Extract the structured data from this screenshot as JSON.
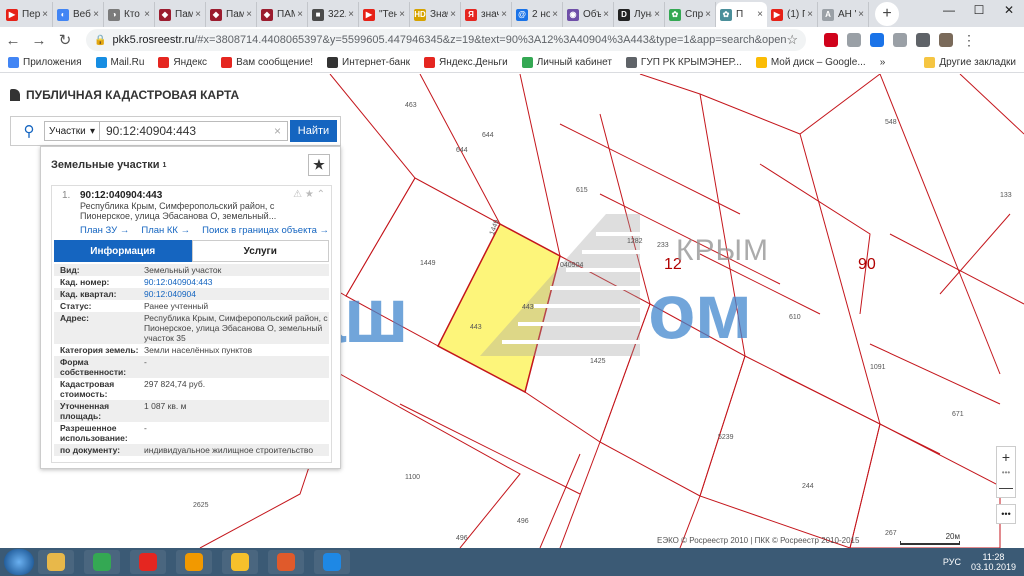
{
  "browser": {
    "tabs": [
      {
        "title": "Пере",
        "color": "#e62117",
        "glyph": "▶"
      },
      {
        "title": "Веб-",
        "color": "#4285f4",
        "glyph": "◐"
      },
      {
        "title": "Кто с",
        "color": "#7b7b7b",
        "glyph": "◑"
      },
      {
        "title": "Памя",
        "color": "#9b1c2e",
        "glyph": "◆"
      },
      {
        "title": "Памя",
        "color": "#9b1c2e",
        "glyph": "◆"
      },
      {
        "title": "ПАМ",
        "color": "#9b1c2e",
        "glyph": "◆"
      },
      {
        "title": "322.р",
        "color": "#4a4a4a",
        "glyph": "■"
      },
      {
        "title": "\"Тень",
        "color": "#e62117",
        "glyph": "▶"
      },
      {
        "title": "Знач",
        "color": "#d6a300",
        "glyph": "HD"
      },
      {
        "title": "знача",
        "color": "#e52620",
        "glyph": "Я"
      },
      {
        "title": "2 нос",
        "color": "#1a73e8",
        "glyph": "@"
      },
      {
        "title": "Объя",
        "color": "#6f4fa8",
        "glyph": "◉"
      },
      {
        "title": "Луна",
        "color": "#222222",
        "glyph": "D"
      },
      {
        "title": "Спра",
        "color": "#34a853",
        "glyph": "✿"
      },
      {
        "title": "П",
        "color": "#4b8f9a",
        "glyph": "✿"
      },
      {
        "title": "(1) П",
        "color": "#e62117",
        "glyph": "▶"
      },
      {
        "title": "АН \"",
        "color": "#9aa0a6",
        "glyph": "A"
      }
    ],
    "active_tab_index": 14,
    "new_tab_label": "+",
    "window_controls": {
      "minimize": "—",
      "maximize": "☐",
      "close": "✕"
    },
    "nav": {
      "back": "←",
      "forward": "→",
      "reload": "↻"
    },
    "url": {
      "host": "pkk5.rosreestr.ru",
      "path": "/#x=3808714.4408065397&y=5599605.447946345&z=19&text=90%3A12%3A40904%3A443&type=1&app=search&opened=1"
    },
    "extensions": [
      {
        "name": "abp-icon",
        "color": "#d0021b"
      },
      {
        "name": "pdf-icon",
        "color": "#9aa0a6"
      },
      {
        "name": "shield-icon",
        "color": "#1a73e8"
      },
      {
        "name": "circle-icon",
        "color": "#9aa0a6"
      },
      {
        "name": "ring-icon",
        "color": "#5f6368"
      },
      {
        "name": "profile-icon",
        "color": "#7a6a5a"
      }
    ],
    "bookmarks": [
      {
        "label": "Приложения",
        "color": "#4285f4"
      },
      {
        "label": "Mail.Ru",
        "color": "#168de2"
      },
      {
        "label": "Яндекс",
        "color": "#e52620"
      },
      {
        "label": "Вам сообщение!",
        "color": "#e52620"
      },
      {
        "label": "Интернет-банк",
        "color": "#333333"
      },
      {
        "label": "Яндекс.Деньги",
        "color": "#e52620"
      },
      {
        "label": "Личный кабинет",
        "color": "#34a853"
      },
      {
        "label": "ГУП РК КРЫМЭНЕР...",
        "color": "#5f6368"
      },
      {
        "label": "Мой диск – Google...",
        "color": "#fbbc05"
      }
    ],
    "bookmarks_more": "»",
    "other_bookmarks": "Другие закладки"
  },
  "app": {
    "title": "ПУБЛИЧНАЯ КАДАСТРОВАЯ КАРТА",
    "search": {
      "type_label": "Участки",
      "query": "90:12:40904:443",
      "clear": "×",
      "button": "Найти"
    },
    "panel": {
      "heading": "Земельные участки",
      "count": "1",
      "star": "★",
      "item": {
        "index": "1.",
        "number": "90:12:040904:443",
        "address": "Республика Крым, Симферопольский район, с Пионерское, улица Эбасанова О, земельный...",
        "icons": "⚠ ★ ⌃",
        "links": [
          "План ЗУ →",
          "План КК →",
          "Поиск в границах объекта →"
        ],
        "tabs": [
          "Информация",
          "Услуги"
        ],
        "rows": [
          {
            "k": "Вид:",
            "v": "Земельный участок",
            "link": false
          },
          {
            "k": "Кад. номер:",
            "v": "90:12:040904:443",
            "link": true
          },
          {
            "k": "Кад. квартал:",
            "v": "90:12:040904",
            "link": true
          },
          {
            "k": "Статус:",
            "v": "Ранее учтенный",
            "link": false
          },
          {
            "k": "Адрес:",
            "v": "Республика Крым, Симферопольский район, с Пионерское, улица Эбасанова О, земельный участок 35",
            "link": false
          },
          {
            "k": "Категория земель:",
            "v": "Земли населённых пунктов",
            "link": false
          },
          {
            "k": "Форма собственности:",
            "v": "-",
            "link": false
          },
          {
            "k": "Кадастровая стоимость:",
            "v": "297 824,74 руб.",
            "link": false
          },
          {
            "k": "Уточненная площадь:",
            "v": "1 087 кв. м",
            "link": false
          },
          {
            "k": "Разрешенное использование:",
            "v": "-",
            "link": false
          },
          {
            "k": "по документу:",
            "v": "индивидуальное жилищное строительство",
            "link": false
          }
        ]
      }
    },
    "map": {
      "parcel_labels": [
        {
          "t": "463"
        },
        {
          "t": "644"
        },
        {
          "t": "644"
        },
        {
          "t": "548"
        },
        {
          "t": "615"
        },
        {
          "t": "133"
        },
        {
          "t": "1282"
        },
        {
          "t": "233"
        },
        {
          "t": "1449"
        },
        {
          "t": "1449"
        },
        {
          "t": "040904"
        },
        {
          "t": "443"
        },
        {
          "t": "443"
        },
        {
          "t": "610"
        },
        {
          "t": "1425"
        },
        {
          "t": "1091"
        },
        {
          "t": "671"
        },
        {
          "t": "5239"
        },
        {
          "t": "244"
        },
        {
          "t": "1100"
        },
        {
          "t": "2625"
        },
        {
          "t": "496"
        },
        {
          "t": "496"
        },
        {
          "t": "267"
        }
      ],
      "district_labels": [
        "12",
        "90"
      ],
      "watermark_left": "Ваш",
      "watermark_right": "ом",
      "watermark_top": "КРЫМ",
      "zoom_in": "+",
      "zoom_sep": "•••",
      "zoom_out": "—",
      "more": "•••",
      "copyright": "ЕЭКО © Росреестр 2010 | ПКК © Росреестр 2010-2015",
      "scale": "20м"
    }
  },
  "taskbar": {
    "icons": [
      {
        "name": "explorer",
        "color": "#e8b84a"
      },
      {
        "name": "chrome",
        "color": "#34a853"
      },
      {
        "name": "yandex",
        "color": "#e52620"
      },
      {
        "name": "media",
        "color": "#f29900"
      },
      {
        "name": "yandex-browser",
        "color": "#f6c02b"
      },
      {
        "name": "security",
        "color": "#e05a2b"
      },
      {
        "name": "ie",
        "color": "#1e88e5"
      }
    ],
    "lang": "РУС",
    "time": "11:28",
    "date": "03.10.2019"
  }
}
